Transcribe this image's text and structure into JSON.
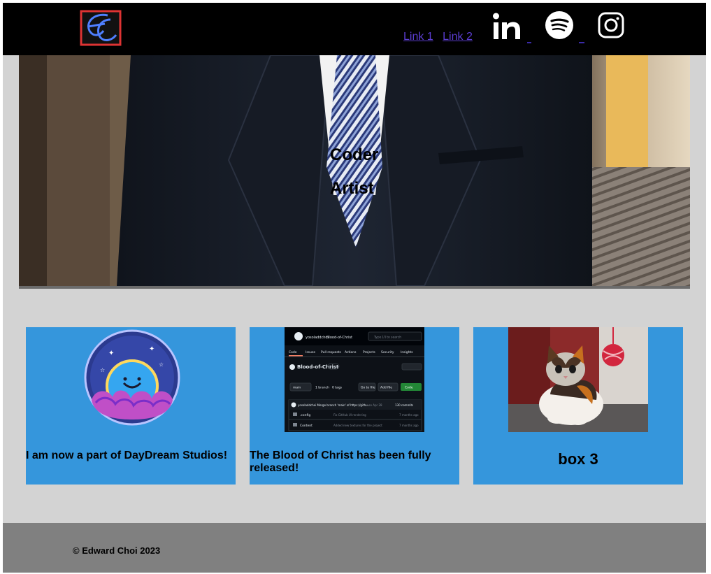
{
  "header": {
    "logo": "ec-monogram-logo",
    "links": [
      {
        "label": "Link 1"
      },
      {
        "label": "Link 2"
      }
    ],
    "social": [
      {
        "icon": "linkedin-icon"
      },
      {
        "icon": "spotify-icon"
      },
      {
        "icon": "instagram-icon"
      }
    ]
  },
  "hero": {
    "lines": [
      "Coder",
      "Artist"
    ]
  },
  "cards": [
    {
      "caption": "I am now a part of DayDream Studios!",
      "image": "daydream-studios-logo"
    },
    {
      "caption": "The Blood of Christ has been fully released!",
      "image": "github-repo-screenshot"
    },
    {
      "caption": "box 3",
      "image": "kitten-photo"
    }
  ],
  "github": {
    "repo_owner": "yosoladdchoi",
    "repo_name": "Blood-of-Christ",
    "visibility": "Private",
    "search_placeholder": "Type [/] to search",
    "tabs": [
      "Code",
      "Issues",
      "Pull requests",
      "Actions",
      "Projects",
      "Security",
      "Insights"
    ],
    "title": "Blood-of-Christ",
    "branch": "main",
    "branches": "1 branch",
    "tags": "0 tags",
    "goto_file": "Go to file",
    "add_file": "Add file",
    "code_btn": "Code",
    "commit_msg": "yosoladdchoi Merge branch 'main' of https://githu...",
    "commit_meta": "on Apr 28",
    "commit_count": "130 commits",
    "files": [
      {
        "name": ".config",
        "msg": "Fix GitHub UI rendering",
        "age": "7 months ago"
      },
      {
        "name": "Content",
        "msg": "Added new textures for the project",
        "age": "7 months ago"
      }
    ]
  },
  "footer": {
    "copyright": "© Edward Choi 2023"
  },
  "colors": {
    "header_bg": "#000000",
    "page_bg": "#d3d3d3",
    "card_bg": "#3596dc",
    "footer_bg": "#808080",
    "link": "#5b3dd1"
  }
}
